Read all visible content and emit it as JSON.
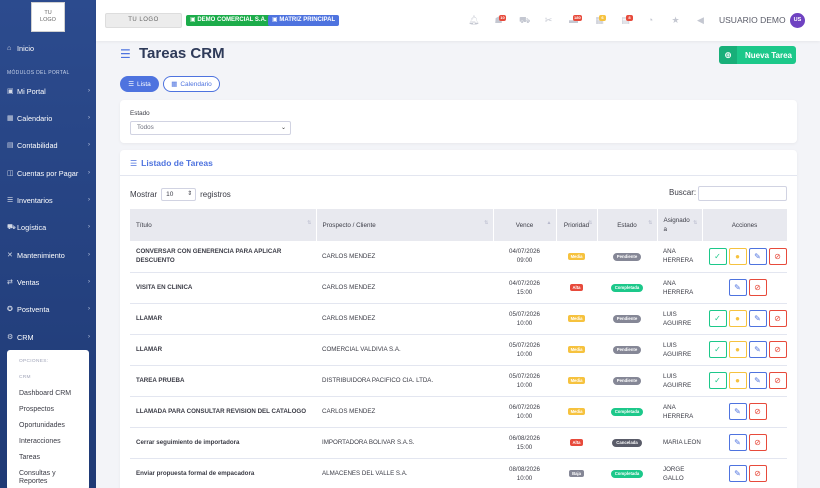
{
  "sidebar": {
    "logo_line1": "TU",
    "logo_line2": "LOGO",
    "section": "MÓDULOS DEL PORTAL",
    "items": [
      {
        "label": "Inicio",
        "icon": "home-icon",
        "glyph": "⌂"
      },
      {
        "label": "Mi Portal",
        "icon": "portal-icon",
        "glyph": "▣"
      },
      {
        "label": "Calendario",
        "icon": "calendar-icon",
        "glyph": "▦"
      },
      {
        "label": "Contabilidad",
        "icon": "accounting-icon",
        "glyph": "▤"
      },
      {
        "label": "Cuentas por Pagar",
        "icon": "payables-icon",
        "glyph": "◫"
      },
      {
        "label": "Inventarios",
        "icon": "inventory-icon",
        "glyph": "☰"
      },
      {
        "label": "Logística",
        "icon": "logistics-icon",
        "glyph": "⛟"
      },
      {
        "label": "Mantenimiento",
        "icon": "maintenance-icon",
        "glyph": "✕"
      },
      {
        "label": "Ventas",
        "icon": "sales-icon",
        "glyph": "⇄"
      },
      {
        "label": "Postventa",
        "icon": "postsale-icon",
        "glyph": "✪"
      },
      {
        "label": "CRM",
        "icon": "crm-icon",
        "glyph": "⚙"
      }
    ],
    "submenu": {
      "head1": "OPCIONES:",
      "head2": "CRM",
      "items": [
        "Dashboard CRM",
        "Prospectos",
        "Oportunidades",
        "Interacciones",
        "Tareas",
        "Consultas y Reportes"
      ]
    }
  },
  "topbar": {
    "logo": "TU LOGO",
    "company": "DEMO COMERCIAL S.A.",
    "branch": "MATRIZ PRINCIPAL",
    "badges": [
      "10",
      "180",
      "6",
      "8"
    ],
    "user": "USUARIO DEMO",
    "avatar": "US"
  },
  "page": {
    "title": "Tareas CRM",
    "new_button": "Nueva Tarea",
    "tabs": [
      "Lista",
      "Calendario"
    ],
    "filter_label": "Estado",
    "filter_value": "Todos",
    "list_title": "Listado de Tareas",
    "show_prefix": "Mostrar",
    "show_value": "10",
    "show_suffix": "registros",
    "search_label": "Buscar:"
  },
  "table": {
    "columns": [
      "Título",
      "Prospecto / Cliente",
      "Vence",
      "Prioridad",
      "Estado",
      "Asignado a",
      "Acciones"
    ],
    "rows": [
      {
        "title": "CONVERSAR CON GENERENCIA PARA APLICAR DESCUENTO",
        "client": "CARLOS MENDEZ",
        "date": "04/07/2026",
        "time": "09:00",
        "priority": "Media",
        "status": "Pendiente",
        "assigned": "ANA HERRERA",
        "bold": true
      },
      {
        "title": "VISITA EN CLINICA",
        "client": "CARLOS MENDEZ",
        "date": "04/07/2026",
        "time": "15:00",
        "priority": "Alta",
        "status": "Completada",
        "assigned": "ANA HERRERA",
        "bold": true
      },
      {
        "title": "LLAMAR",
        "client": "CARLOS MENDEZ",
        "date": "05/07/2026",
        "time": "10:00",
        "priority": "Media",
        "status": "Pendiente",
        "assigned": "LUIS AGUIRRE",
        "bold": true
      },
      {
        "title": "LLAMAR",
        "client": "COMERCIAL VALDIVIA S.A.",
        "date": "05/07/2026",
        "time": "10:00",
        "priority": "Media",
        "status": "Pendiente",
        "assigned": "LUIS AGUIRRE",
        "bold": true
      },
      {
        "title": "TAREA PRUEBA",
        "client": "DISTRIBUIDORA PACIFICO CIA. LTDA.",
        "date": "05/07/2026",
        "time": "10:00",
        "priority": "Media",
        "status": "Pendiente",
        "assigned": "LUIS AGUIRRE",
        "bold": true
      },
      {
        "title": "LLAMADA PARA CONSULTAR REVISION DEL CATALOGO",
        "client": "CARLOS MENDEZ",
        "date": "06/07/2026",
        "time": "10:00",
        "priority": "Media",
        "status": "Completada",
        "assigned": "ANA HERRERA",
        "bold": true
      },
      {
        "title": "Cerrar seguimiento de importadora",
        "client": "IMPORTADORA BOLIVAR S.A.S.",
        "date": "06/08/2026",
        "time": "15:00",
        "priority": "Alta",
        "status": "Cancelada",
        "assigned": "MARIA LEON",
        "bold": true
      },
      {
        "title": "Enviar propuesta formal de empacadora",
        "client": "ALMACENES DEL VALLE S.A.",
        "date": "08/08/2026",
        "time": "10:00",
        "priority": "Baja",
        "status": "Completada",
        "assigned": "JORGE GALLO",
        "bold": true
      }
    ]
  },
  "colors": {
    "primary": "#4e73df",
    "success": "#1cc88a",
    "media": "#f6c23e",
    "alta": "#e74a3b",
    "baja": "#858796",
    "pendiente": "#858796",
    "completada": "#1cc88a",
    "cancelada": "#5a5c69"
  }
}
